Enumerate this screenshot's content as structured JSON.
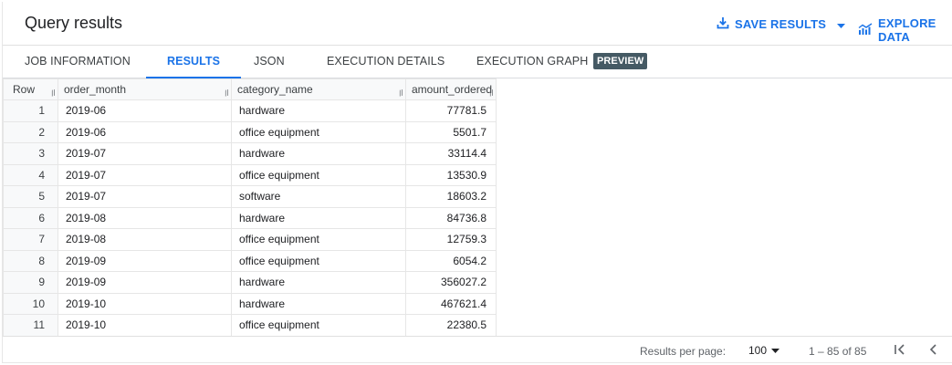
{
  "header": {
    "title": "Query results",
    "save_label": "SAVE RESULTS",
    "explore_label": "EXPLORE DATA",
    "accent_color": "#1a73e8"
  },
  "tabs": [
    {
      "label": "JOB INFORMATION",
      "active": false
    },
    {
      "label": "RESULTS",
      "active": true
    },
    {
      "label": "JSON",
      "active": false
    },
    {
      "label": "EXECUTION DETAILS",
      "active": false
    },
    {
      "label": "EXECUTION GRAPH",
      "active": false,
      "badge": "PREVIEW"
    }
  ],
  "table": {
    "columns": [
      "Row",
      "order_month",
      "category_name",
      "amount_ordered"
    ],
    "rows": [
      [
        "1",
        "2019-06",
        "hardware",
        "77781.5"
      ],
      [
        "2",
        "2019-06",
        "office equipment",
        "5501.7"
      ],
      [
        "3",
        "2019-07",
        "hardware",
        "33114.4"
      ],
      [
        "4",
        "2019-07",
        "office equipment",
        "13530.9"
      ],
      [
        "5",
        "2019-07",
        "software",
        "18603.2"
      ],
      [
        "6",
        "2019-08",
        "hardware",
        "84736.8"
      ],
      [
        "7",
        "2019-08",
        "office equipment",
        "12759.3"
      ],
      [
        "8",
        "2019-09",
        "office equipment",
        "6054.2"
      ],
      [
        "9",
        "2019-09",
        "hardware",
        "356027.2"
      ],
      [
        "10",
        "2019-10",
        "hardware",
        "467621.4"
      ],
      [
        "11",
        "2019-10",
        "office equipment",
        "22380.5"
      ]
    ]
  },
  "footer": {
    "rows_per_page_label": "Results per page:",
    "rows_per_page_value": "100",
    "range_text": "1 – 85 of 85"
  },
  "icons": {
    "save": "download-icon",
    "explore": "chart-icon",
    "first_page": "first-page-icon",
    "prev_page": "chevron-left-icon"
  }
}
